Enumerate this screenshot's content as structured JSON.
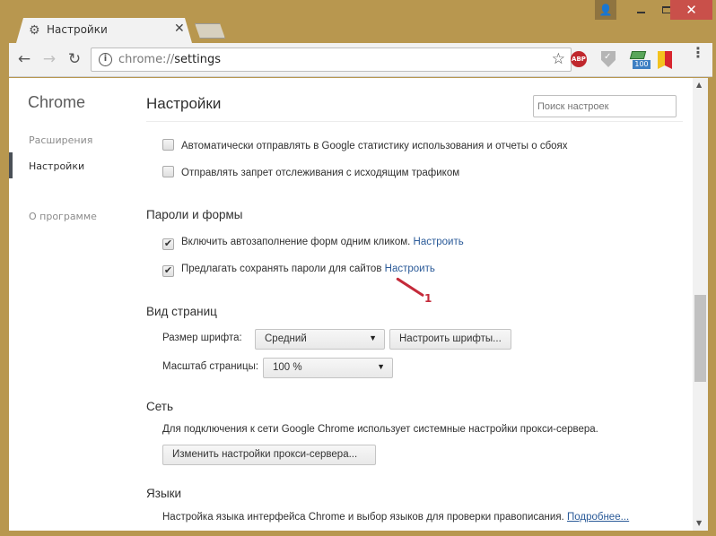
{
  "window": {
    "controls": {
      "minimize": "minimize",
      "maximize": "maximize",
      "close": "✕"
    }
  },
  "tab": {
    "title": "Настройки",
    "close": "✕"
  },
  "toolbar": {
    "url_scheme": "chrome://",
    "url_path": "settings",
    "extensions": {
      "abp_label": "ABP",
      "money_badge": "100"
    }
  },
  "sidebar": {
    "title": "Chrome",
    "items": [
      {
        "label": "Расширения",
        "active": false
      },
      {
        "label": "Настройки",
        "active": true
      },
      {
        "label": "О программе",
        "active": false
      }
    ]
  },
  "header": {
    "title": "Настройки",
    "search_placeholder": "Поиск настроек"
  },
  "privacy": {
    "options": [
      {
        "label": "Автоматически отправлять в Google статистику использования и отчеты о сбоях",
        "checked": false
      },
      {
        "label": "Отправлять запрет отслеживания с исходящим трафиком",
        "checked": false
      }
    ]
  },
  "passwords": {
    "title": "Пароли и формы",
    "options": [
      {
        "label": "Включить автозаполнение форм одним кликом.",
        "link": "Настроить",
        "checked": true
      },
      {
        "label": "Предлагать сохранять пароли для сайтов",
        "link": "Настроить",
        "checked": true
      }
    ],
    "annotation": "1"
  },
  "appearance": {
    "title": "Вид страниц",
    "font_size_label": "Размер шрифта:",
    "font_size_value": "Средний",
    "customize_fonts_button": "Настроить шрифты...",
    "zoom_label": "Масштаб страницы:",
    "zoom_value": "100 %"
  },
  "network": {
    "title": "Сеть",
    "description": "Для подключения к сети Google Chrome использует системные настройки прокси-сервера.",
    "proxy_button": "Изменить настройки прокси-сервера..."
  },
  "languages": {
    "title": "Языки",
    "description": "Настройка языка интерфейса Chrome и выбор языков для проверки правописания.",
    "more_link": "Подробнее..."
  }
}
